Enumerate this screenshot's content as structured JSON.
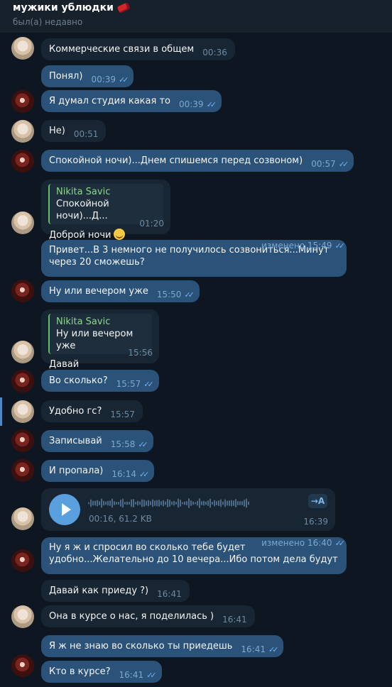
{
  "header": {
    "title": "мужики ублюдки",
    "status": "был(а) недавно"
  },
  "reply_author": "Nikita Savic",
  "messages": [
    {
      "text": "Коммерческие связи в общем",
      "time": "00:36"
    },
    {
      "text": "Понял)",
      "time": "00:39"
    },
    {
      "text": "Я думал студия какая то",
      "time": "00:39"
    },
    {
      "text": "Не)",
      "time": "00:51"
    },
    {
      "text": "Спокойной ночи)...Днем спишемся перед созвоном)",
      "time": "00:57"
    },
    {
      "reply": "Спокойной ночи)...Д...",
      "text": "Доброй ночи",
      "time": "01:20"
    },
    {
      "text": "Привет...В 3 немного не получилось созвониться...Минут через 20 сможешь?",
      "time": "изменено 15:49"
    },
    {
      "text": "Ну или вечером уже",
      "time": "15:50"
    },
    {
      "reply": "Ну или вечером уже",
      "text": "Давай",
      "time": "15:56"
    },
    {
      "text": "Во сколько?",
      "time": "15:57"
    },
    {
      "text": "Удобно гс?",
      "time": "15:57"
    },
    {
      "text": "Записывай",
      "time": "15:58"
    },
    {
      "text": "И пропала)",
      "time": "16:14"
    },
    {
      "voice_info": "00:16, 61.2 KB",
      "transcribe_label": "→A",
      "time": "16:39"
    },
    {
      "text": "Ну я ж и спросил во сколько тебе будет удобно...Желательно до 10 вечера...Ибо потом дела будут",
      "time": "изменено 16:40"
    },
    {
      "text": "Давай как приеду ?)",
      "time": "16:41"
    },
    {
      "text": "Она в курсе о нас, я поделилась )",
      "time": "16:41"
    },
    {
      "text": "Я ж не знаю во сколько ты приедешь",
      "time": "16:41"
    },
    {
      "text": "Кто в курсе?",
      "time": "16:41"
    }
  ],
  "colors": {
    "background": "#0e1621",
    "incoming_bubble": "#182533",
    "outgoing_bubble": "#2b5278",
    "read_check": "#73b5f3",
    "reply_accent": "#66bb6a"
  }
}
